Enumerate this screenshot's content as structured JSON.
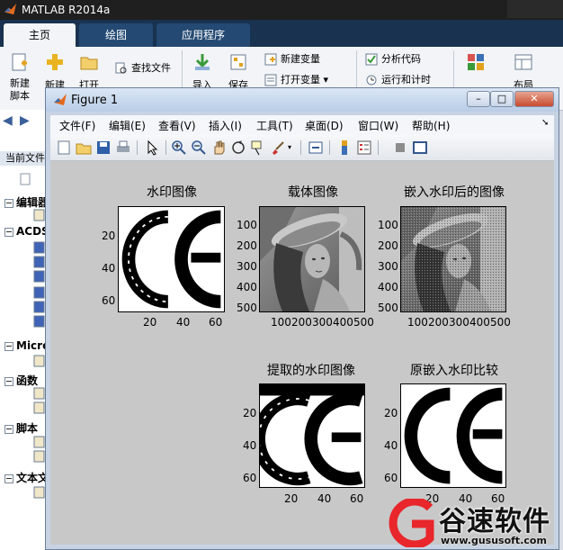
{
  "app": {
    "title": "MATLAB R2014a",
    "tabs": [
      {
        "label": "主页",
        "active": true
      },
      {
        "label": "绘图",
        "active": false
      },
      {
        "label": "应用程序",
        "active": false
      }
    ],
    "ribbon": {
      "new_script": "新建\n脚本",
      "new": "新建",
      "open": "打开",
      "find_files": "查找文件",
      "new_variable": "新建变量",
      "open_variable": "打开变量 ▾",
      "analyze_code": "分析代码",
      "run_and_time": "运行和计时",
      "import": "导入",
      "save": "保存",
      "layout": "布局"
    },
    "left_panel": {
      "current_folder": "当前文件",
      "groups": [
        {
          "label": "编辑器"
        },
        {
          "label": "ACDS"
        },
        {
          "label": "Micro"
        },
        {
          "label": "函数"
        },
        {
          "label": "脚本"
        },
        {
          "label": "文本文"
        }
      ]
    }
  },
  "figure": {
    "title": "Figure 1",
    "menus": [
      "文件(F)",
      "编辑(E)",
      "查看(V)",
      "插入(I)",
      "工具(T)",
      "桌面(D)",
      "窗口(W)",
      "帮助(H)"
    ],
    "plots": [
      {
        "title": "水印图像",
        "xticks": [
          "20",
          "40",
          "60"
        ],
        "yticks": [
          "20",
          "40",
          "60"
        ]
      },
      {
        "title": "载体图像",
        "xticks": [
          "100",
          "200",
          "300",
          "400",
          "500"
        ],
        "yticks": [
          "100",
          "200",
          "300",
          "400",
          "500"
        ]
      },
      {
        "title": "嵌入水印后的图像",
        "xticks": [
          "100",
          "200",
          "300",
          "400",
          "500"
        ],
        "yticks": [
          "100",
          "200",
          "300",
          "400",
          "500"
        ]
      },
      {
        "title": "提取的水印图像",
        "xticks": [
          "20",
          "40",
          "60"
        ],
        "yticks": [
          "20",
          "40",
          "60"
        ]
      },
      {
        "title": "原嵌入水印比较",
        "xticks": [
          "20",
          "40",
          "60"
        ],
        "yticks": [
          "20",
          "40",
          "60"
        ]
      }
    ]
  },
  "watermark": {
    "brand": "谷速软件",
    "url": "www.gususoft.com"
  },
  "colors": {
    "ribbon_tab_bar": "#18324f",
    "figure_frame": "#c7d3e3",
    "plot_background": "#c8c8c8",
    "watermark_red": "#e8262b"
  }
}
